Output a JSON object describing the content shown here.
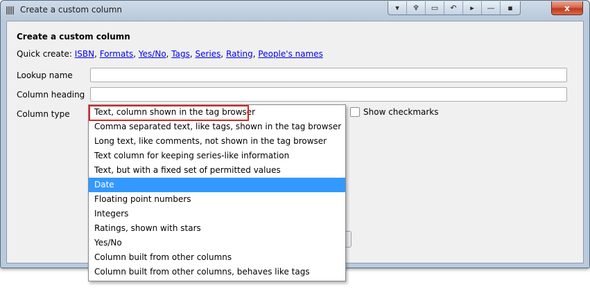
{
  "window": {
    "title": "Create a custom column",
    "toolbar_icons": [
      "menu-icon",
      "wrench-icon",
      "restore-icon",
      "undo-icon",
      "pin-icon",
      "minimize-icon",
      "dot-icon"
    ],
    "toolbar_glyphs": [
      "▾",
      "♆",
      "▭",
      "↶",
      "▸",
      "—",
      "▪"
    ],
    "close_label": "x"
  },
  "dialog": {
    "heading": "Create a custom column",
    "quick_create_label": "Quick create:",
    "quick_links": [
      "ISBN",
      "Formats",
      "Yes/No",
      "Tags",
      "Series",
      "Rating",
      "People's names"
    ],
    "lookup_label": "Lookup name",
    "lookup_value": "",
    "heading_label": "Column heading",
    "heading_value": "",
    "type_label": "Column type",
    "show_checkmarks_label": "Show checkmarks",
    "show_checkmarks_checked": false
  },
  "dropdown": {
    "selected_value": "Text, column shown in the tag browser",
    "hovered_index": 5,
    "items": [
      "Text, column shown in the tag browser",
      "Comma separated text, like tags, shown in the tag browser",
      "Long text, like comments, not shown in the tag browser",
      "Text column for keeping series-like information",
      "Text, but with a fixed set of permitted values",
      "Date",
      "Floating point numbers",
      "Integers",
      "Ratings, shown with stars",
      "Yes/No",
      "Column built from other columns",
      "Column built from other columns, behaves like tags"
    ]
  },
  "colors": {
    "selection": "#3399ff",
    "link": "#0000ee",
    "highlight_box": "#e02020"
  }
}
